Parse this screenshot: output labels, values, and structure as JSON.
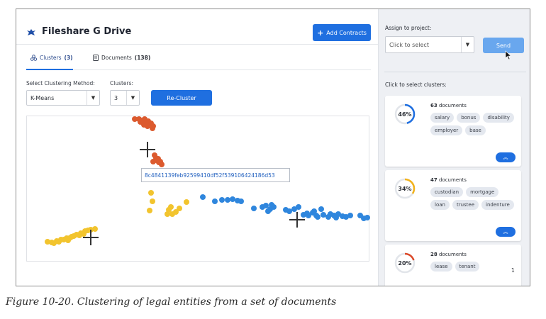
{
  "app": {
    "title": "Fileshare G Drive",
    "add_button": "Add Contracts"
  },
  "tabs": [
    {
      "label": "Clusters",
      "count": "(3)",
      "active": true
    },
    {
      "label": "Documents",
      "count": "(138)",
      "active": false
    }
  ],
  "controls": {
    "method_label": "Select Clustering Method:",
    "method_value": "K-Means",
    "clusters_label": "Clusters:",
    "clusters_value": "3",
    "recluster_button": "Re-Cluster"
  },
  "tooltip": "8c4841139feb92599410df52f539106424186d53",
  "plot": {
    "colors": {
      "orange": "#dc5a2e",
      "yellow": "#f2c42e",
      "blue": "#2f86dd",
      "centroid": "#333333"
    },
    "clusters": [
      {
        "color": "orange",
        "points": [
          [
            152,
            4
          ],
          [
            158,
            4
          ],
          [
            161,
            6
          ],
          [
            166,
            4
          ],
          [
            171,
            7
          ],
          [
            175,
            10
          ],
          [
            178,
            14
          ],
          [
            177,
            17
          ],
          [
            165,
            12
          ],
          [
            170,
            14
          ],
          [
            160,
            8
          ],
          [
            168,
            8
          ],
          [
            180,
            55
          ],
          [
            182,
            59
          ],
          [
            185,
            60
          ],
          [
            186,
            65
          ],
          [
            188,
            64
          ],
          [
            190,
            68
          ],
          [
            178,
            64
          ],
          [
            183,
            62
          ]
        ]
      },
      {
        "color": "yellow",
        "points": [
          [
            29,
            177
          ],
          [
            35,
            178
          ],
          [
            42,
            176
          ],
          [
            48,
            174
          ],
          [
            56,
            172
          ],
          [
            63,
            170
          ],
          [
            70,
            167
          ],
          [
            76,
            165
          ],
          [
            82,
            162
          ],
          [
            90,
            160
          ],
          [
            45,
            177
          ],
          [
            52,
            174
          ],
          [
            58,
            175
          ],
          [
            66,
            169
          ],
          [
            74,
            168
          ],
          [
            80,
            166
          ],
          [
            96,
            159
          ],
          [
            175,
            108
          ],
          [
            177,
            120
          ],
          [
            173,
            133
          ],
          [
            198,
            138
          ],
          [
            205,
            138
          ],
          [
            210,
            135
          ],
          [
            200,
            132
          ],
          [
            203,
            128
          ],
          [
            215,
            130
          ],
          [
            225,
            121
          ],
          [
            86,
            161
          ],
          [
            60,
            172
          ],
          [
            38,
            179
          ]
        ]
      },
      {
        "color": "blue",
        "points": [
          [
            248,
            114
          ],
          [
            265,
            120
          ],
          [
            275,
            118
          ],
          [
            283,
            118
          ],
          [
            290,
            117
          ],
          [
            297,
            119
          ],
          [
            302,
            120
          ],
          [
            320,
            130
          ],
          [
            332,
            128
          ],
          [
            337,
            126
          ],
          [
            343,
            131
          ],
          [
            345,
            125
          ],
          [
            340,
            134
          ],
          [
            348,
            128
          ],
          [
            365,
            132
          ],
          [
            370,
            134
          ],
          [
            377,
            131
          ],
          [
            383,
            128
          ],
          [
            390,
            139
          ],
          [
            397,
            140
          ],
          [
            403,
            136
          ],
          [
            405,
            134
          ],
          [
            408,
            140
          ],
          [
            415,
            131
          ],
          [
            418,
            139
          ],
          [
            428,
            138
          ],
          [
            433,
            140
          ],
          [
            439,
            138
          ],
          [
            445,
            141
          ],
          [
            450,
            142
          ],
          [
            456,
            140
          ],
          [
            470,
            140
          ],
          [
            475,
            144
          ],
          [
            480,
            143
          ],
          [
            395,
            137
          ],
          [
            410,
            142
          ],
          [
            425,
            142
          ],
          [
            436,
            143
          ]
        ]
      }
    ],
    "centroids": [
      [
        170,
        47
      ],
      [
        90,
        171
      ],
      [
        381,
        146
      ]
    ]
  },
  "side": {
    "assign_label": "Assign to project:",
    "assign_placeholder": "Click to select",
    "send_button": "Send",
    "select_label": "Click to select clusters:"
  },
  "cards": [
    {
      "percent": "46%",
      "fraction": 0.46,
      "ring_color": "#1f6fe0",
      "count": "63",
      "docs_label": "documents",
      "terms": [
        "salary",
        "bonus",
        "disability",
        "employer",
        "base"
      ]
    },
    {
      "percent": "34%",
      "fraction": 0.34,
      "ring_color": "#f2b21b",
      "count": "47",
      "docs_label": "documents",
      "terms": [
        "custodian",
        "mortgage",
        "loan",
        "trustee",
        "indenture"
      ]
    },
    {
      "percent": "20%",
      "fraction": 0.2,
      "ring_color": "#dc4a2a",
      "count": "28",
      "docs_label": "documents",
      "terms": [
        "lease",
        "tenant"
      ],
      "trailing": "1"
    }
  ],
  "caption": "Figure 10-20. Clustering of legal entities from a set of documents"
}
